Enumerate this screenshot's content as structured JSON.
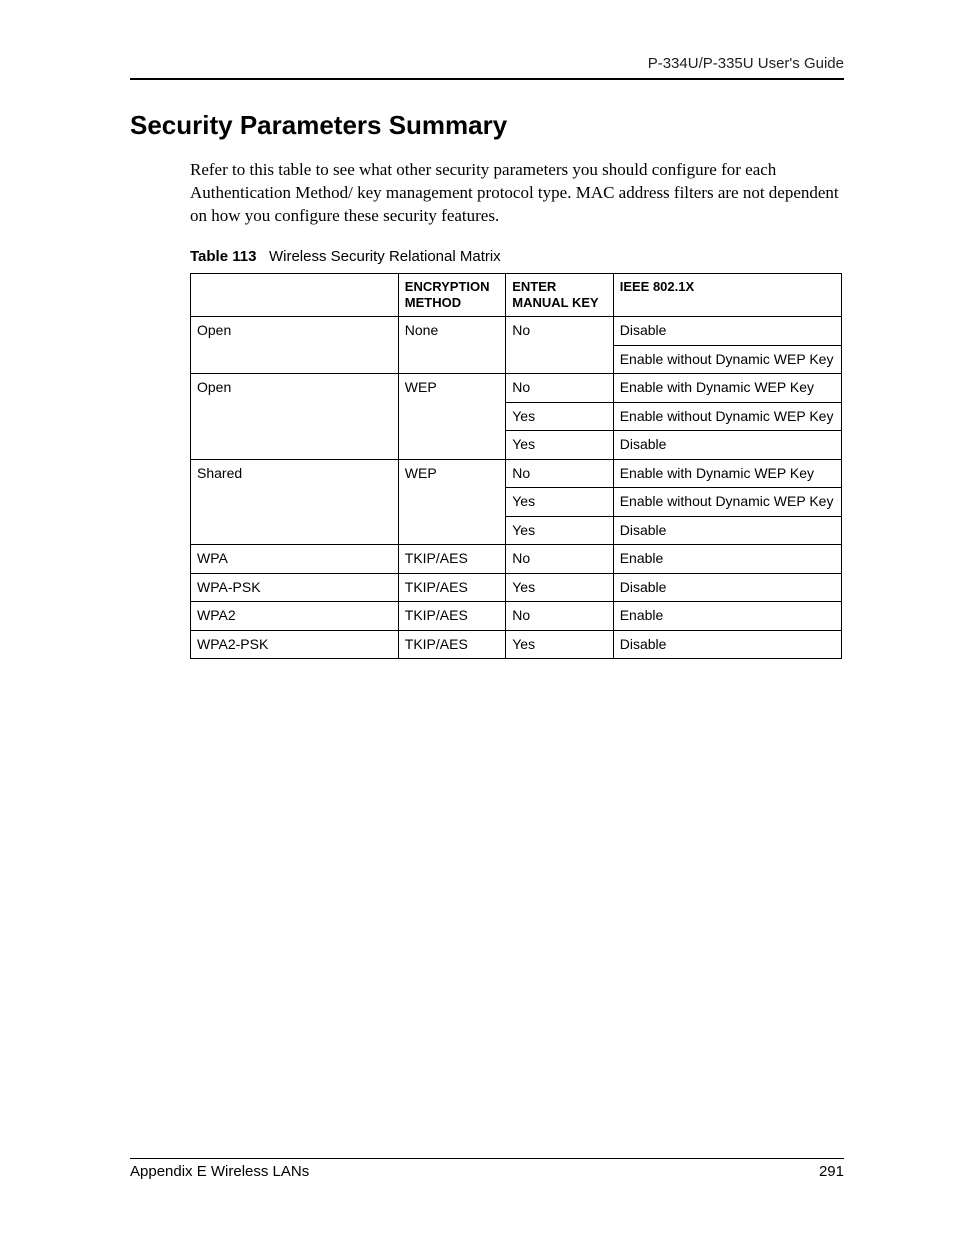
{
  "header": {
    "guide_title": "P-334U/P-335U User's Guide"
  },
  "section": {
    "title": "Security Parameters Summary",
    "intro": "Refer to this table to see what other security parameters you should configure for each Authentication Method/ key management protocol type. MAC address filters are not dependent on how you configure these security features."
  },
  "table": {
    "caption_label": "Table 113",
    "caption_text": "Wireless Security Relational Matrix",
    "headers": {
      "col1": "",
      "col2": "ENCRYPTION METHOD",
      "col3": "ENTER MANUAL KEY",
      "col4": "IEEE 802.1X"
    },
    "rows": {
      "open_none": {
        "auth": "Open",
        "enc": "None",
        "r1": {
          "key": "No",
          "ieee": "Disable"
        },
        "r2": {
          "ieee": "Enable without Dynamic WEP Key"
        }
      },
      "open_wep": {
        "auth": "Open",
        "enc": "WEP",
        "r1": {
          "key": "No",
          "ieee": "Enable with Dynamic WEP Key"
        },
        "r2": {
          "key": "Yes",
          "ieee": "Enable without Dynamic WEP Key"
        },
        "r3": {
          "key": "Yes",
          "ieee": "Disable"
        }
      },
      "shared_wep": {
        "auth": "Shared",
        "enc": "WEP",
        "r1": {
          "key": "No",
          "ieee": "Enable with Dynamic WEP Key"
        },
        "r2": {
          "key": "Yes",
          "ieee": "Enable without Dynamic WEP Key"
        },
        "r3": {
          "key": "Yes",
          "ieee": "Disable"
        }
      },
      "wpa": {
        "auth": "WPA",
        "enc": "TKIP/AES",
        "key": "No",
        "ieee": "Enable"
      },
      "wpa_psk": {
        "auth": "WPA-PSK",
        "enc": "TKIP/AES",
        "key": "Yes",
        "ieee": "Disable"
      },
      "wpa2": {
        "auth": "WPA2",
        "enc": "TKIP/AES",
        "key": "No",
        "ieee": "Enable"
      },
      "wpa2_psk": {
        "auth": "WPA2-PSK",
        "enc": "TKIP/AES",
        "key": "Yes",
        "ieee": "Disable"
      }
    }
  },
  "footer": {
    "left": "Appendix E Wireless LANs",
    "right": "291"
  }
}
